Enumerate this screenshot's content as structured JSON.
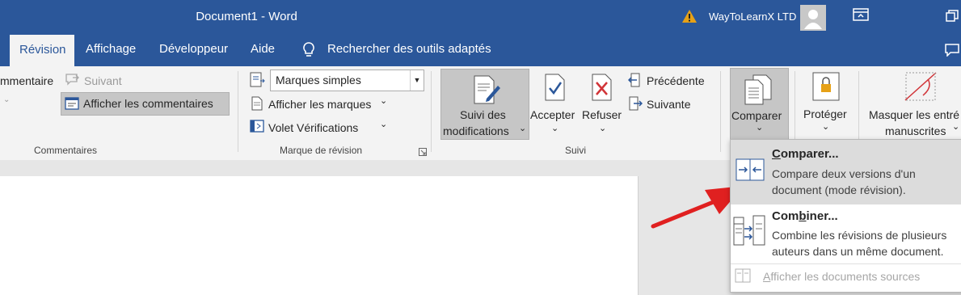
{
  "window": {
    "title": "Document1  -  Word",
    "user": "WayToLearnX LTD"
  },
  "tabs": {
    "revision": "Révision",
    "affichage": "Affichage",
    "developpeur": "Développeur",
    "aide": "Aide",
    "search": "Rechercher des outils adaptés"
  },
  "ribbon": {
    "commentaires": {
      "comment_label": "mmentaire",
      "suivant": "Suivant",
      "afficher_commentaires": "Afficher les commentaires",
      "group": "Commentaires"
    },
    "marque": {
      "dropdown_value": "Marques simples",
      "afficher_marques": "Afficher les marques",
      "volet": "Volet Vérifications",
      "group": "Marque de révision"
    },
    "suivi": {
      "suivi_line1": "Suivi des",
      "suivi_line2": "modifications",
      "accepter": "Accepter",
      "refuser": "Refuser",
      "precedente": "Précédente",
      "suivante": "Suivante",
      "group": "Suivi"
    },
    "comparer": {
      "label": "Comparer"
    },
    "proteger": {
      "label": "Protéger"
    },
    "encre": {
      "line1": "Masquer les entré",
      "line2": "manuscrites"
    }
  },
  "compare_menu": {
    "compare_title_underlined": "C",
    "compare_title_rest": "omparer...",
    "compare_desc1": "Compare deux versions d'un",
    "compare_desc2": "document (mode révision).",
    "combine_title_first": "Com",
    "combine_title_underlined": "b",
    "combine_title_rest": "iner...",
    "combine_desc1": "Combine les révisions de plusieurs",
    "combine_desc2": "auteurs dans un même document.",
    "sources_underlined": "A",
    "sources_rest": "fficher les documents sources"
  },
  "colors": {
    "brand": "#2b579a",
    "warning": "#e6a117",
    "arrow": "#e02020"
  }
}
